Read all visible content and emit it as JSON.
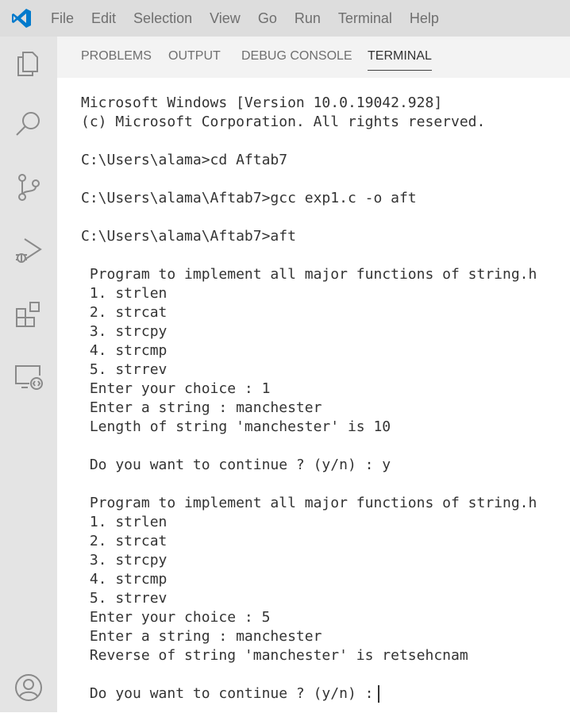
{
  "menu": {
    "items": [
      "File",
      "Edit",
      "Selection",
      "View",
      "Go",
      "Run",
      "Terminal",
      "Help"
    ]
  },
  "activity_bar": {
    "icons": [
      "explorer-icon",
      "search-icon",
      "source-control-icon",
      "run-debug-icon",
      "extensions-icon",
      "remote-explorer-icon",
      "account-icon"
    ]
  },
  "panel": {
    "tabs": [
      "PROBLEMS",
      "OUTPUT",
      "DEBUG CONSOLE",
      "TERMINAL"
    ],
    "active_tab": "TERMINAL"
  },
  "terminal": {
    "lines": [
      "Microsoft Windows [Version 10.0.19042.928]",
      "(c) Microsoft Corporation. All rights reserved.",
      "",
      "C:\\Users\\alama>cd Aftab7",
      "",
      "C:\\Users\\alama\\Aftab7>gcc exp1.c -o aft",
      "",
      "C:\\Users\\alama\\Aftab7>aft",
      "",
      " Program to implement all major functions of string.h",
      " 1. strlen",
      " 2. strcat",
      " 3. strcpy",
      " 4. strcmp",
      " 5. strrev",
      " Enter your choice : 1",
      " Enter a string : manchester",
      " Length of string 'manchester' is 10",
      "",
      " Do you want to continue ? (y/n) : y",
      "",
      " Program to implement all major functions of string.h",
      " 1. strlen",
      " 2. strcat",
      " 3. strcpy",
      " 4. strcmp",
      " 5. strrev",
      " Enter your choice : 5",
      " Enter a string : manchester",
      " Reverse of string 'manchester' is retsehcnam",
      "",
      " Do you want to continue ? (y/n) :"
    ]
  },
  "colors": {
    "accent": "#007acc",
    "title_bar": "#dddddd",
    "activity_bar": "#e4e4e4",
    "terminal_text": "#333333"
  }
}
